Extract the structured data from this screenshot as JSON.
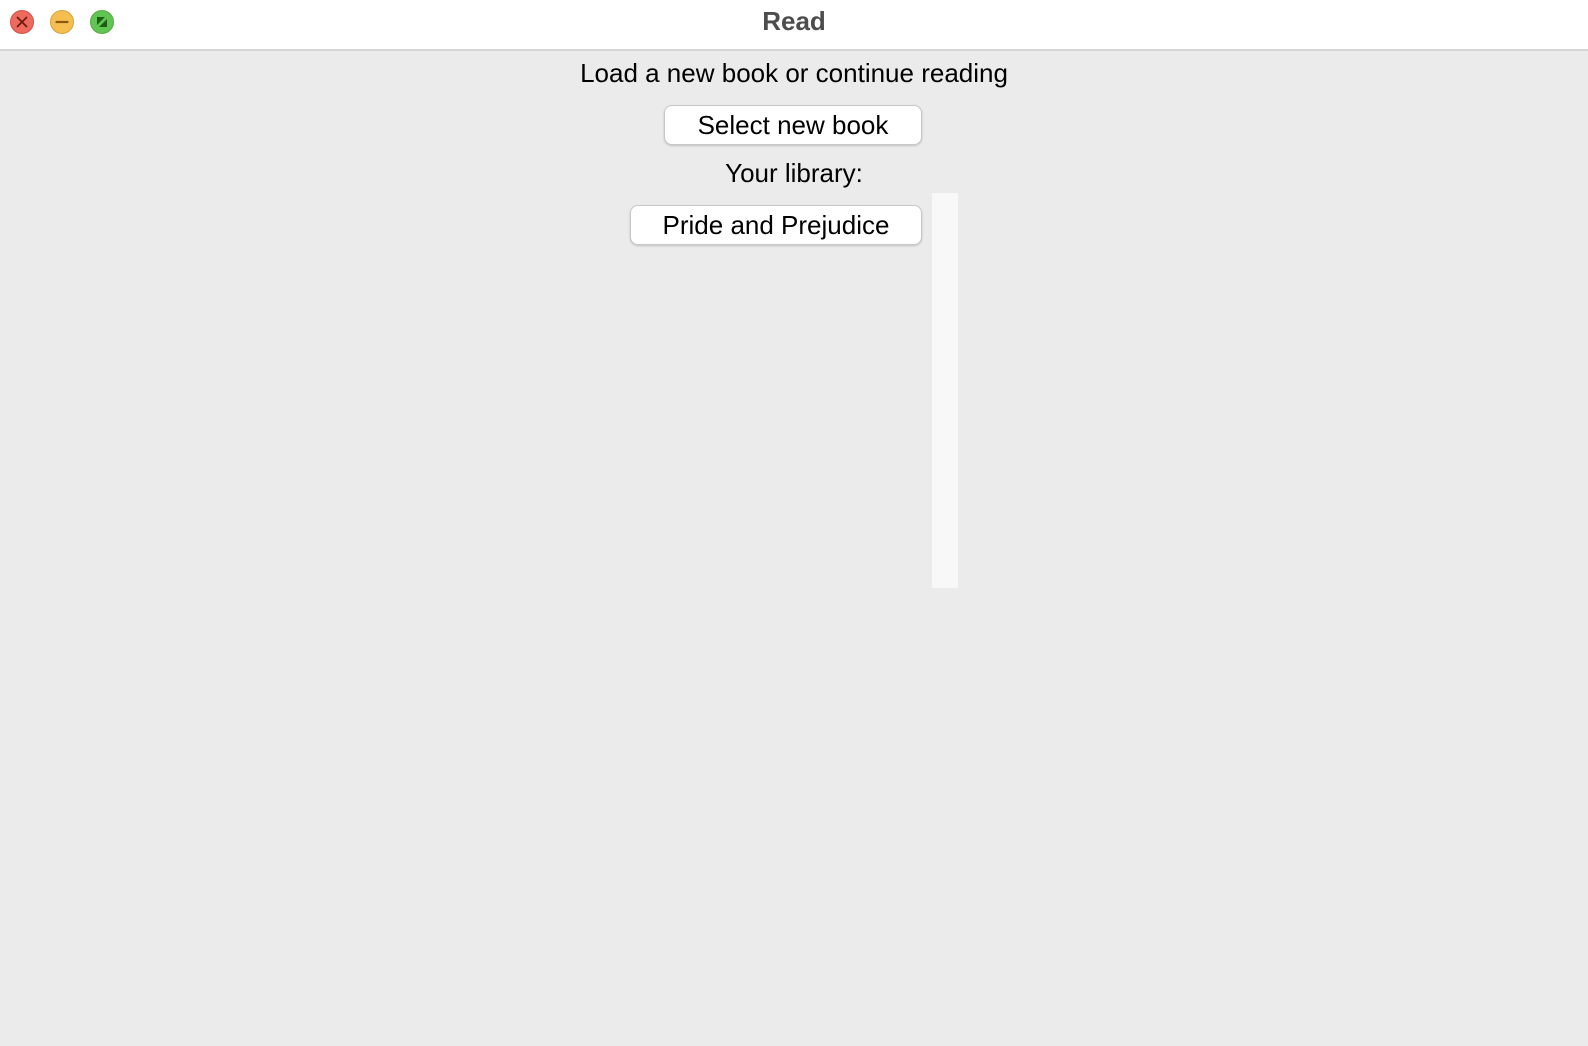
{
  "window": {
    "title": "Read",
    "controls": [
      "close-icon",
      "minimize-icon",
      "zoom-icon"
    ],
    "colors": {
      "close": "#ee6a5f",
      "minimize": "#f5bf4f",
      "zoom": "#61c554"
    }
  },
  "main": {
    "prompt": "Load a new book or continue reading",
    "select_button_label": "Select new book",
    "library_label": "Your library:",
    "books": [
      {
        "title": "Pride and Prejudice"
      }
    ]
  }
}
